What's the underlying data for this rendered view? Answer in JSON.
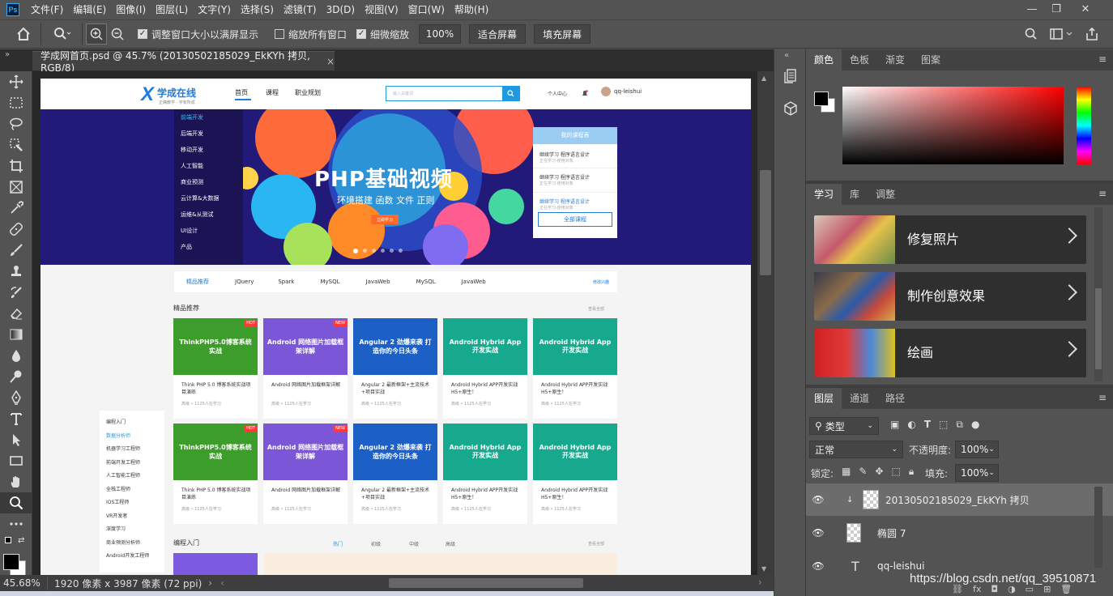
{
  "menu": [
    "文件(F)",
    "编辑(E)",
    "图像(I)",
    "图层(L)",
    "文字(Y)",
    "选择(S)",
    "滤镜(T)",
    "3D(D)",
    "视图(V)",
    "窗口(W)",
    "帮助(H)"
  ],
  "window_controls": [
    "—",
    "❐",
    "✕"
  ],
  "options": {
    "resize_windows_label": "调整窗口大小以满屏显示",
    "zoom_all_label": "缩放所有窗口",
    "scrubby_label": "细微缩放",
    "zoom_value": "100%",
    "fit_screen": "适合屏幕",
    "fill_screen": "填充屏幕"
  },
  "document_tab": {
    "title": "学成网首页.psd @ 45.7% (20130502185029_EkKYh 拷贝, RGB/8)",
    "close": "×"
  },
  "status": {
    "zoom": "45.68%",
    "info": "1920 像素 x 3987 像素 (72 ppi)"
  },
  "color_panel": {
    "tabs": [
      "颜色",
      "色板",
      "渐变",
      "图案"
    ],
    "active": "颜色"
  },
  "learn_panel": {
    "tabs": [
      "学习",
      "库",
      "调整"
    ],
    "cards": [
      {
        "label": "修复照片"
      },
      {
        "label": "制作创意效果"
      },
      {
        "label": "绘画"
      }
    ]
  },
  "layers_panel": {
    "tabs": [
      "图层",
      "通道",
      "路径"
    ],
    "filter": "类型",
    "blend_mode": "正常",
    "opacity_label": "不透明度:",
    "opacity": "100%",
    "lock_label": "锁定:",
    "fill_label": "填充:",
    "fill": "100%",
    "layers": [
      {
        "name": "20130502185029_EkKYh 拷贝"
      },
      {
        "name": "椭圆 7"
      },
      {
        "name": "qq-leishui"
      }
    ]
  },
  "watermark": "https://blog.csdn.net/qq_39510871",
  "site": {
    "logo": "学成在线",
    "logo_sub": "正确教学 · 学有所成",
    "nav": [
      "首页",
      "课程",
      "职业规划"
    ],
    "search_placeholder": "输入关键词",
    "user_center": "个人中心",
    "username": "qq-leishui",
    "sidebar": [
      "前端开发",
      "后端开发",
      "移动开发",
      "人工智能",
      "商业预测",
      "云计算&大数据",
      "运维&从测试",
      "UI设计",
      "产品"
    ],
    "banner_title": "PHP基础视频",
    "banner_sub": "环境搭建  函数  文件  正则",
    "banner_btn": "立即学习",
    "my_courses_title": "我的课程表",
    "my_courses": [
      {
        "title": "继续学习 程序语言设计",
        "sub": "正在学习-使用对象"
      },
      {
        "title": "继续学习 程序语言设计",
        "sub": "正在学习-使用对象"
      },
      {
        "title": "继续学习 程序语言设计",
        "sub": "正在学习-使用对象"
      }
    ],
    "all_courses_btn": "全部课程",
    "tags": [
      "精品推荐",
      "JQuery",
      "Spark",
      "MySQL",
      "JavaWeb",
      "MySQL",
      "JavaWeb"
    ],
    "tags_edit": "修改兴趣",
    "section1_title": "精品推荐",
    "section_more": "查看全部",
    "cards": [
      {
        "img": "ThinkPHP5.0博客系统实战",
        "title": "Think PHP 5.0 博客系统实战项目演练",
        "meta": "高级 • 1125人在学习",
        "color": "#3c9d2a",
        "badge": "HOT"
      },
      {
        "img": "Android 网络图片加载框架详解",
        "title": "Android 网络图片加载框架详解",
        "meta": "高级 • 1125人在学习",
        "color": "#7b56d6",
        "badge": "NEW"
      },
      {
        "img": "Angular 2 劲爆来袭 打造你的今日头条",
        "title": "Angular 2 最新框架+主流技术+项目实战",
        "meta": "高级 • 1125人在学习",
        "color": "#1b5fc7",
        "badge": ""
      },
      {
        "img": "Android Hybrid App开发实战",
        "title": "Android Hybrid APP开发实战 H5+原生！",
        "meta": "高级 • 1125人在学习",
        "color": "#16a98d",
        "badge": ""
      },
      {
        "img": "Android Hybrid App开发实战",
        "title": "Android Hybrid APP开发实战 H5+原生！",
        "meta": "高级 • 1125人在学习",
        "color": "#16a98d",
        "badge": ""
      }
    ],
    "left_menu": [
      "编程入门",
      "数据分析师",
      "机器学习工程师",
      "前端开发工程师",
      "人工智能工程师",
      "全栈工程师",
      "IOS工程师",
      "VR开发者",
      "深度学习",
      "商业预测分析师",
      "Android开发工程师"
    ],
    "section2_title": "编程入门",
    "section2_tabs": [
      "热门",
      "初级",
      "中级",
      "高级"
    ]
  }
}
